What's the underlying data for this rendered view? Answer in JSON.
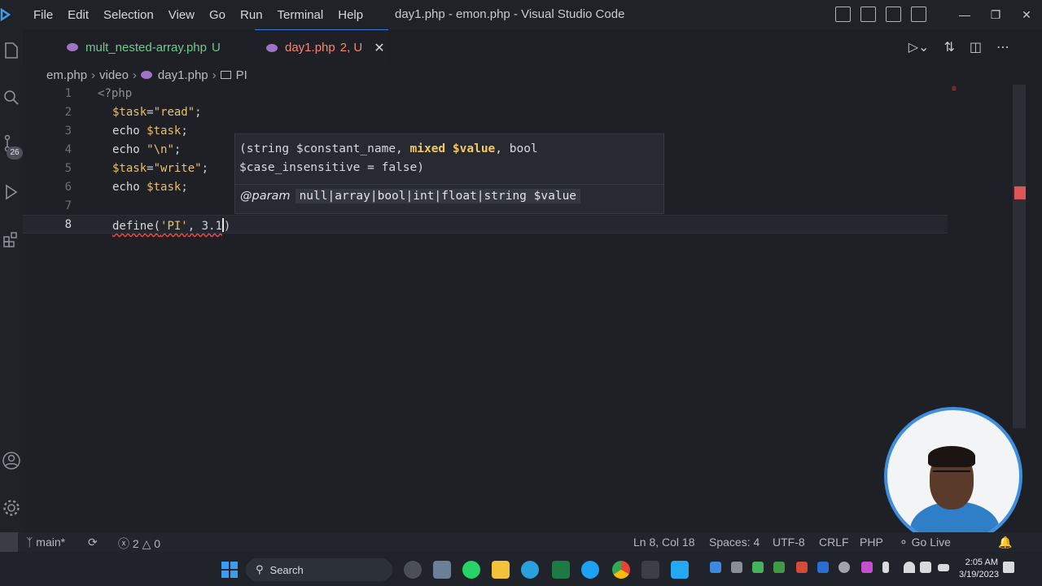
{
  "menu": [
    "File",
    "Edit",
    "Selection",
    "View",
    "Go",
    "Run",
    "Terminal",
    "Help"
  ],
  "window_title": "day1.php - emon.php - Visual Studio Code",
  "tabs": [
    {
      "name": "mult_nested-array.php",
      "status": "U",
      "active": false
    },
    {
      "name": "day1.php",
      "status": "2, U",
      "active": true
    }
  ],
  "breadcrumb": [
    "em.php",
    "video",
    "day1.php",
    "PI"
  ],
  "activity": {
    "badge": "26"
  },
  "code": {
    "lines": [
      {
        "num": "1",
        "text": "<?php"
      },
      {
        "num": "2",
        "var": "$task",
        "str": "\"read\"",
        "end": ";"
      },
      {
        "num": "3",
        "kw": "echo ",
        "var": "$task",
        "end": ";"
      },
      {
        "num": "4",
        "kw": "echo ",
        "str": "\"\\n\"",
        "end": ";"
      },
      {
        "num": "5",
        "var": "$task",
        "str": "\"write\"",
        "end": ";"
      },
      {
        "num": "6",
        "kw": "echo ",
        "var": "$task",
        "end": ";"
      },
      {
        "num": "7",
        "text": ""
      },
      {
        "num": "8",
        "fn": "define(",
        "str": "'PI'",
        "rest": ", 3.1",
        "close": ")"
      }
    ]
  },
  "hover": {
    "sig_pre": "(string $constant_name, ",
    "sig_hl": "mixed $value",
    "sig_post": ", bool $case_insensitive = false)",
    "param_tag": "@param",
    "param_type": "null|array|bool|int|float|string $value"
  },
  "status": {
    "branch": "main*",
    "errors": "2",
    "warnings": "0",
    "position": "Ln 8, Col 18",
    "spaces": "Spaces: 4",
    "encoding": "UTF-8",
    "eol": "CRLF",
    "language": "PHP",
    "golive": "Go Live"
  },
  "taskbar": {
    "search": "Search",
    "time": "2:05 AM",
    "date": "3/19/2023"
  },
  "colors": {
    "accent": "#3a7bd5",
    "error": "#f14c4c",
    "untracked": "#73c991",
    "errored_tab": "#f48771"
  }
}
